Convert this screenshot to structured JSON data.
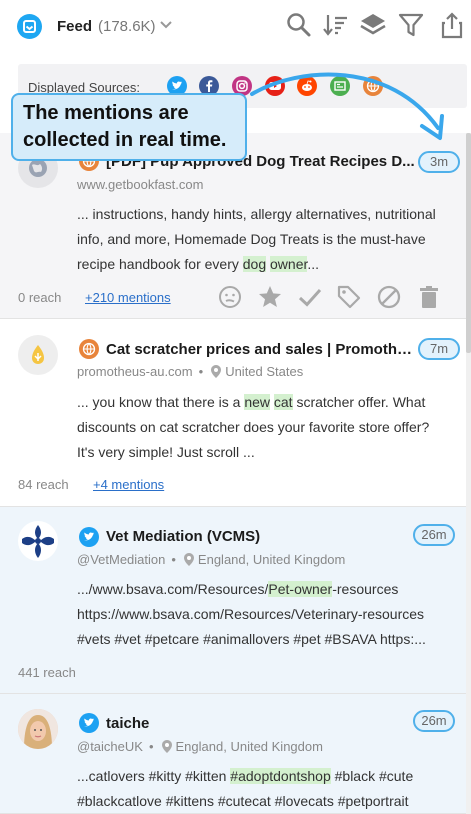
{
  "header": {
    "title": "Feed",
    "count": "(178.6K)",
    "tools": [
      "search-icon",
      "sort-icon",
      "layers-icon",
      "filter-icon",
      "share-icon"
    ]
  },
  "sources": {
    "label": "Displayed Sources:",
    "items": [
      {
        "name": "twitter",
        "color": "#1da1f2"
      },
      {
        "name": "facebook",
        "color": "#3b5998"
      },
      {
        "name": "instagram",
        "color": "#c13584"
      },
      {
        "name": "youtube",
        "color": "#e62117"
      },
      {
        "name": "reddit",
        "color": "#ff4500"
      },
      {
        "name": "news",
        "color": "#4caf50"
      },
      {
        "name": "web",
        "color": "#e8843b"
      }
    ]
  },
  "tooltip": {
    "line1": "The mentions are",
    "line2": "collected in real time."
  },
  "cards": [
    {
      "source": "web",
      "title": "[PDF] Pup Approved Dog Treat Recipes D...",
      "domain": "www.getbookfast.com",
      "location": "",
      "time": "3m",
      "snippet_parts": [
        "... instructions, handy hints, allergy alternatives, nutritional info, and more, Homemade Dog Treats is the must-have recipe handbook for every ",
        "dog",
        " ",
        "owner",
        "..."
      ],
      "reach": "0 reach",
      "mentions": "+210 mentions"
    },
    {
      "source": "web",
      "title": "Cat scratcher prices and sales | Promotheus",
      "domain": "promotheus-au.com",
      "location": "United States",
      "time": "7m",
      "snippet_parts": [
        "... you know that there is a ",
        "new",
        " ",
        "cat",
        " scratcher offer. What discounts on cat scratcher does your favorite store offer? It's very simple! Just scroll ..."
      ],
      "reach": "84 reach",
      "mentions": "+4 mentions"
    },
    {
      "source": "twitter",
      "title": "Vet Mediation (VCMS)",
      "domain": "@VetMediation",
      "location": "England, United Kingdom",
      "time": "26m",
      "snippet_parts": [
        ".../www.bsava.com/Resources/",
        "Pet-owner",
        "-resources https://www.bsava.com/Resources/Veterinary-resources #vets #vet #petcare #animallovers #pet #BSAVA https:..."
      ],
      "reach": "441 reach",
      "mentions": ""
    },
    {
      "source": "twitter",
      "title": "taiche",
      "domain": "@taicheUK",
      "location": "England, United Kingdom",
      "time": "26m",
      "snippet_parts": [
        "...catlovers #kitty #kitten ",
        "#adoptdontshop",
        " #black #cute #blackcatlove #kittens #cutecat #lovecats #petportrait"
      ],
      "reach": "",
      "mentions": ""
    }
  ]
}
